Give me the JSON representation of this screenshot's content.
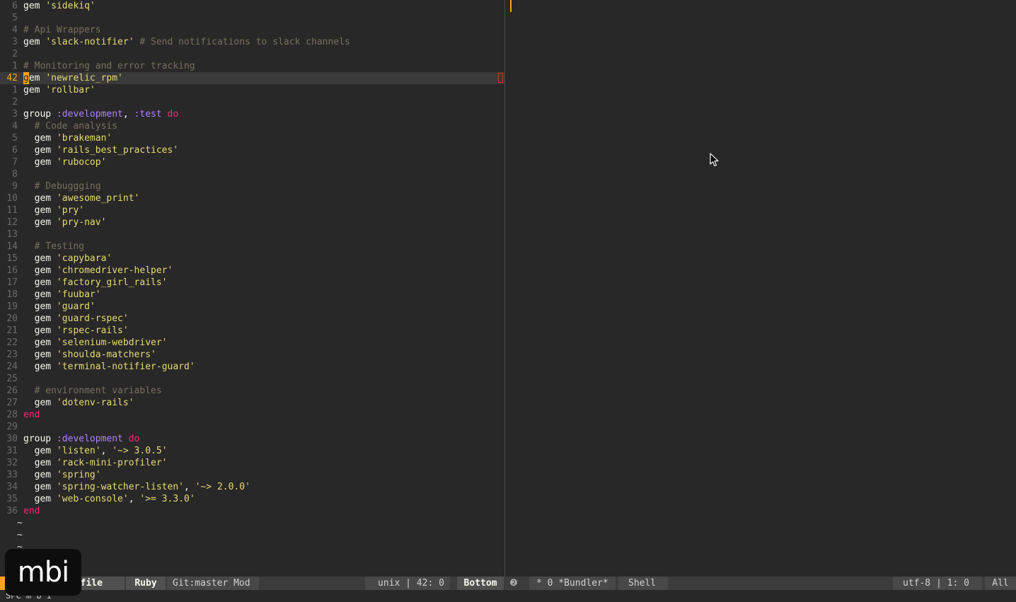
{
  "editor": {
    "current_line_index": 5,
    "lines": [
      {
        "num": "6",
        "tokens": [
          {
            "t": "gem ",
            "c": "kw"
          },
          {
            "t": "'sidekiq'",
            "c": "str"
          }
        ]
      },
      {
        "num": "5",
        "tokens": []
      },
      {
        "num": "4",
        "tokens": [
          {
            "t": "# Api Wrappers",
            "c": "cmt"
          }
        ]
      },
      {
        "num": "3",
        "tokens": [
          {
            "t": "gem ",
            "c": "kw"
          },
          {
            "t": "'slack-notifier'",
            "c": "str"
          },
          {
            "t": " # Send notifications to slack channels",
            "c": "cmt"
          }
        ]
      },
      {
        "num": "2",
        "tokens": []
      },
      {
        "num": "1",
        "tokens": [
          {
            "t": "# Monitoring and error tracking",
            "c": "cmt"
          }
        ]
      },
      {
        "num": "42",
        "tokens": [
          {
            "t": "g",
            "c": "cursor"
          },
          {
            "t": "em ",
            "c": "kw"
          },
          {
            "t": "'newrelic_rpm'",
            "c": "str"
          }
        ]
      },
      {
        "num": "1",
        "tokens": [
          {
            "t": "gem ",
            "c": "kw"
          },
          {
            "t": "'rollbar'",
            "c": "str"
          }
        ]
      },
      {
        "num": "2",
        "tokens": []
      },
      {
        "num": "3",
        "tokens": [
          {
            "t": "group ",
            "c": "kw"
          },
          {
            "t": ":development",
            "c": "sym"
          },
          {
            "t": ", ",
            "c": "plain"
          },
          {
            "t": ":test",
            "c": "sym"
          },
          {
            "t": " do",
            "c": "red"
          }
        ]
      },
      {
        "num": "4",
        "tokens": [
          {
            "t": "  # Code analysis",
            "c": "cmt"
          }
        ]
      },
      {
        "num": "5",
        "tokens": [
          {
            "t": "  gem ",
            "c": "kw"
          },
          {
            "t": "'brakeman'",
            "c": "str"
          }
        ]
      },
      {
        "num": "6",
        "tokens": [
          {
            "t": "  gem ",
            "c": "kw"
          },
          {
            "t": "'rails_best_practices'",
            "c": "str"
          }
        ]
      },
      {
        "num": "7",
        "tokens": [
          {
            "t": "  gem ",
            "c": "kw"
          },
          {
            "t": "'rubocop'",
            "c": "str"
          }
        ]
      },
      {
        "num": "8",
        "tokens": []
      },
      {
        "num": "9",
        "tokens": [
          {
            "t": "  # Debuggging",
            "c": "cmt"
          }
        ]
      },
      {
        "num": "10",
        "tokens": [
          {
            "t": "  gem ",
            "c": "kw"
          },
          {
            "t": "'awesome_print'",
            "c": "str"
          }
        ]
      },
      {
        "num": "11",
        "tokens": [
          {
            "t": "  gem ",
            "c": "kw"
          },
          {
            "t": "'pry'",
            "c": "str"
          }
        ]
      },
      {
        "num": "12",
        "tokens": [
          {
            "t": "  gem ",
            "c": "kw"
          },
          {
            "t": "'pry-nav'",
            "c": "str"
          }
        ]
      },
      {
        "num": "13",
        "tokens": []
      },
      {
        "num": "14",
        "tokens": [
          {
            "t": "  # Testing",
            "c": "cmt"
          }
        ]
      },
      {
        "num": "15",
        "tokens": [
          {
            "t": "  gem ",
            "c": "kw"
          },
          {
            "t": "'capybara'",
            "c": "str"
          }
        ]
      },
      {
        "num": "16",
        "tokens": [
          {
            "t": "  gem ",
            "c": "kw"
          },
          {
            "t": "'chromedriver-helper'",
            "c": "str"
          }
        ]
      },
      {
        "num": "17",
        "tokens": [
          {
            "t": "  gem ",
            "c": "kw"
          },
          {
            "t": "'factory_girl_rails'",
            "c": "str"
          }
        ]
      },
      {
        "num": "18",
        "tokens": [
          {
            "t": "  gem ",
            "c": "kw"
          },
          {
            "t": "'fuubar'",
            "c": "str"
          }
        ]
      },
      {
        "num": "19",
        "tokens": [
          {
            "t": "  gem ",
            "c": "kw"
          },
          {
            "t": "'guard'",
            "c": "str"
          }
        ]
      },
      {
        "num": "20",
        "tokens": [
          {
            "t": "  gem ",
            "c": "kw"
          },
          {
            "t": "'guard-rspec'",
            "c": "str"
          }
        ]
      },
      {
        "num": "21",
        "tokens": [
          {
            "t": "  gem ",
            "c": "kw"
          },
          {
            "t": "'rspec-rails'",
            "c": "str"
          }
        ]
      },
      {
        "num": "22",
        "tokens": [
          {
            "t": "  gem ",
            "c": "kw"
          },
          {
            "t": "'selenium-webdriver'",
            "c": "str"
          }
        ]
      },
      {
        "num": "23",
        "tokens": [
          {
            "t": "  gem ",
            "c": "kw"
          },
          {
            "t": "'shoulda-matchers'",
            "c": "str"
          }
        ]
      },
      {
        "num": "24",
        "tokens": [
          {
            "t": "  gem ",
            "c": "kw"
          },
          {
            "t": "'terminal-notifier-guard'",
            "c": "str"
          }
        ]
      },
      {
        "num": "25",
        "tokens": []
      },
      {
        "num": "26",
        "tokens": [
          {
            "t": "  # environment variables",
            "c": "cmt"
          }
        ]
      },
      {
        "num": "27",
        "tokens": [
          {
            "t": "  gem ",
            "c": "kw"
          },
          {
            "t": "'dotenv-rails'",
            "c": "str"
          }
        ]
      },
      {
        "num": "28",
        "tokens": [
          {
            "t": "end",
            "c": "red"
          }
        ]
      },
      {
        "num": "29",
        "tokens": []
      },
      {
        "num": "30",
        "tokens": [
          {
            "t": "group ",
            "c": "kw"
          },
          {
            "t": ":development",
            "c": "sym"
          },
          {
            "t": " do",
            "c": "red"
          }
        ]
      },
      {
        "num": "31",
        "tokens": [
          {
            "t": "  gem ",
            "c": "kw"
          },
          {
            "t": "'listen'",
            "c": "str"
          },
          {
            "t": ", ",
            "c": "plain"
          },
          {
            "t": "'~> 3.0.5'",
            "c": "str"
          }
        ]
      },
      {
        "num": "32",
        "tokens": [
          {
            "t": "  gem ",
            "c": "kw"
          },
          {
            "t": "'rack-mini-profiler'",
            "c": "str"
          }
        ]
      },
      {
        "num": "33",
        "tokens": [
          {
            "t": "  gem ",
            "c": "kw"
          },
          {
            "t": "'spring'",
            "c": "str"
          }
        ]
      },
      {
        "num": "34",
        "tokens": [
          {
            "t": "  gem ",
            "c": "kw"
          },
          {
            "t": "'spring-watcher-listen'",
            "c": "str"
          },
          {
            "t": ", ",
            "c": "plain"
          },
          {
            "t": "'~> 2.0.0'",
            "c": "str"
          }
        ]
      },
      {
        "num": "35",
        "tokens": [
          {
            "t": "  gem ",
            "c": "kw"
          },
          {
            "t": "'web-console'",
            "c": "str"
          },
          {
            "t": ", ",
            "c": "plain"
          },
          {
            "t": "'>= 3.3.0'",
            "c": "str"
          }
        ]
      },
      {
        "num": "36",
        "tokens": [
          {
            "t": "end",
            "c": "red"
          }
        ]
      }
    ],
    "tilde_lines": [
      "~",
      "~",
      "~",
      "~",
      "~"
    ]
  },
  "mode_line": {
    "buffer_name": "Gemfile",
    "buffer_name_visible": "emfile",
    "major_mode": "Ruby",
    "vc_status": "Git:master Mod",
    "encoding_position": "unix | 42: 0",
    "scroll_position": "Bottom",
    "help_icon": "❷",
    "right_buffer": "* 0 *Bundler*",
    "right_mode": "Shell",
    "right_encoding": "utf-8 | 1: 0",
    "right_scroll": "All"
  },
  "echo_area": {
    "text": "SPC m b i"
  },
  "watermark": {
    "text": "mbi"
  },
  "colors": {
    "background": "#282828",
    "accent": "#f5a623",
    "string": "#e6db74",
    "comment": "#75715e",
    "symbol": "#ae81ff",
    "keyword_red": "#f92672"
  }
}
